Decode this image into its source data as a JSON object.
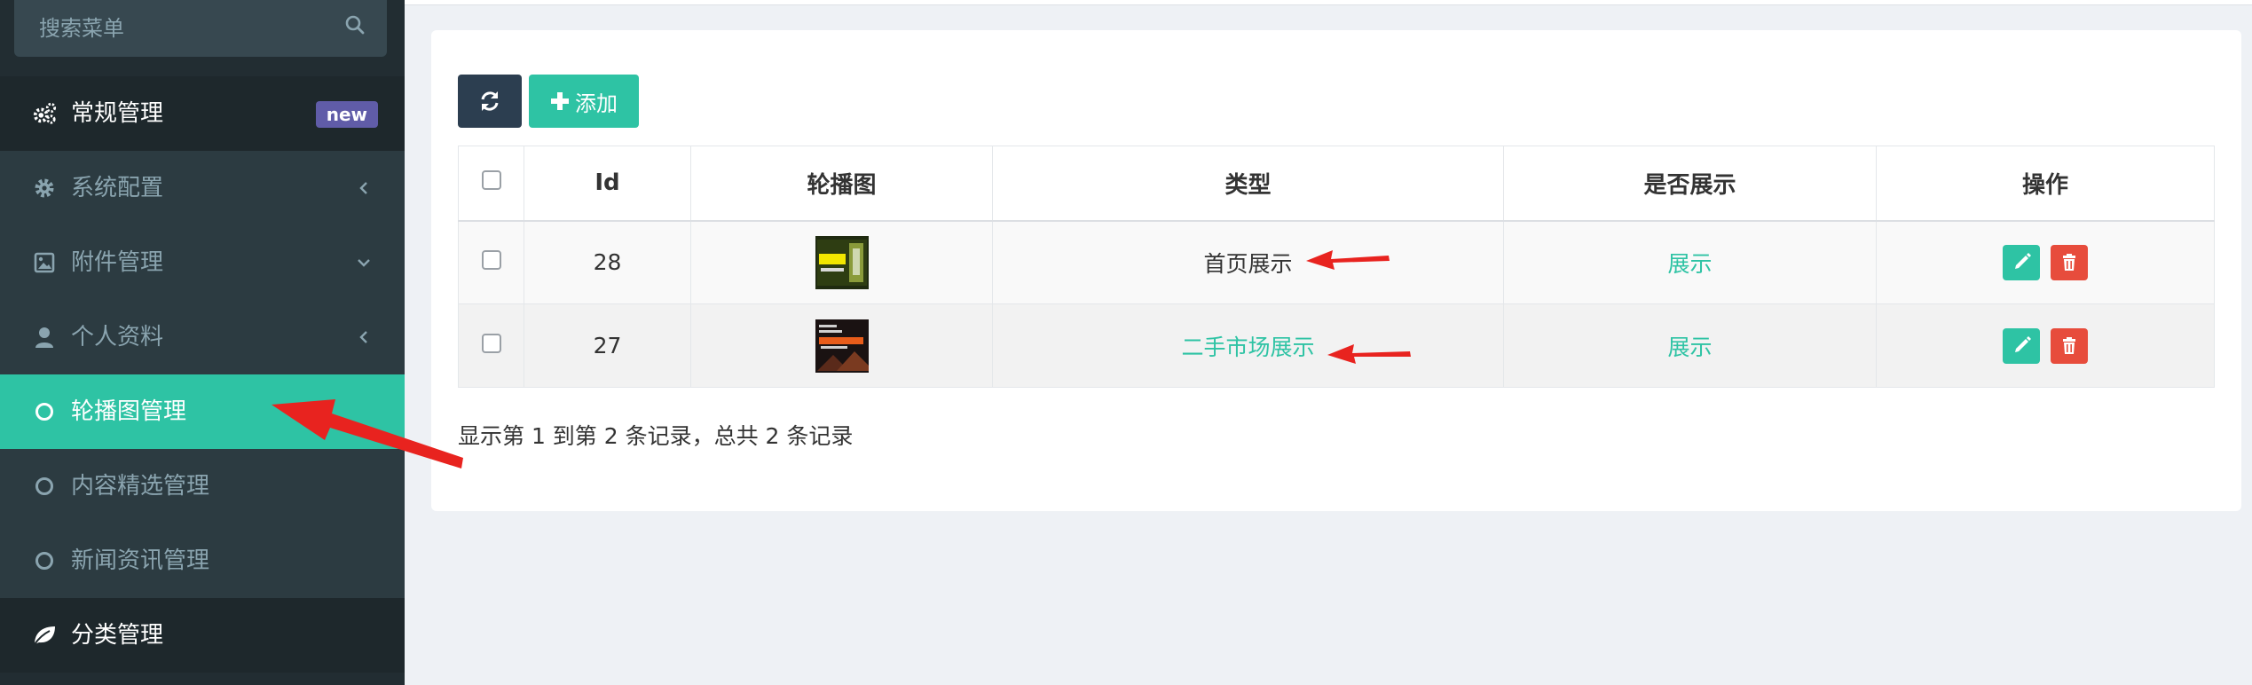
{
  "sidebar": {
    "search_placeholder": "搜索菜单",
    "items": [
      {
        "label": "常规管理",
        "badge": "new"
      },
      {
        "label": "系统配置"
      },
      {
        "label": "附件管理"
      },
      {
        "label": "个人资料"
      },
      {
        "label": "轮播图管理"
      },
      {
        "label": "内容精选管理"
      },
      {
        "label": "新闻资讯管理"
      },
      {
        "label": "分类管理"
      }
    ]
  },
  "toolbar": {
    "add_label": "添加"
  },
  "table": {
    "columns": [
      "Id",
      "轮播图",
      "类型",
      "是否展示",
      "操作"
    ],
    "rows": [
      {
        "id": "28",
        "type": "首页展示",
        "display": "展示"
      },
      {
        "id": "27",
        "type": "二手市场展示",
        "display": "展示"
      }
    ]
  },
  "footer": {
    "summary": "显示第 1 到第 2 条记录，总共 2 条记录"
  },
  "colors": {
    "accent": "#2ec3a4",
    "danger": "#e74c3c",
    "sidebar": "#222d32",
    "arrow": "#e8231f"
  }
}
